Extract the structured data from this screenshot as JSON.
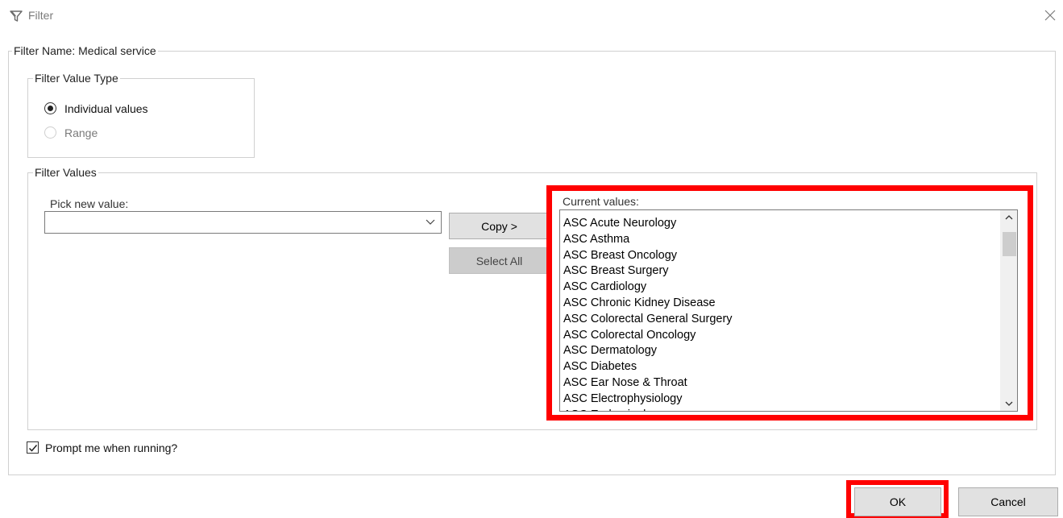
{
  "window": {
    "title": "Filter",
    "icon": "funnel-icon",
    "close_icon": "close-icon"
  },
  "filter_name": {
    "legend": "Filter Name: Medical service"
  },
  "value_type": {
    "legend": "Filter Value Type",
    "options": [
      {
        "label": "Individual values",
        "selected": true,
        "enabled": true
      },
      {
        "label": "Range",
        "selected": false,
        "enabled": false
      }
    ]
  },
  "filter_values": {
    "legend": "Filter Values",
    "pick_label": "Pick new value:",
    "pick_value": "",
    "copy_label": "Copy >",
    "select_all_label": "Select All",
    "current_label": "Current values:",
    "current_values": [
      "ASC Acute Neurology",
      "ASC Asthma",
      "ASC Breast Oncology",
      "ASC Breast Surgery",
      "ASC Cardiology",
      "ASC Chronic Kidney Disease",
      "ASC Colorectal General Surgery",
      "ASC Colorectal Oncology",
      "ASC Dermatology",
      "ASC Diabetes",
      "ASC Ear Nose & Throat",
      "ASC Electrophysiology",
      "ASC Endocrinology"
    ]
  },
  "prompt": {
    "label": "Prompt me when running?",
    "checked": true
  },
  "buttons": {
    "ok": "OK",
    "cancel": "Cancel"
  },
  "colors": {
    "highlight": "#ff0000",
    "button_bg": "#e1e1e1",
    "disabled_button_bg": "#cccccc"
  }
}
